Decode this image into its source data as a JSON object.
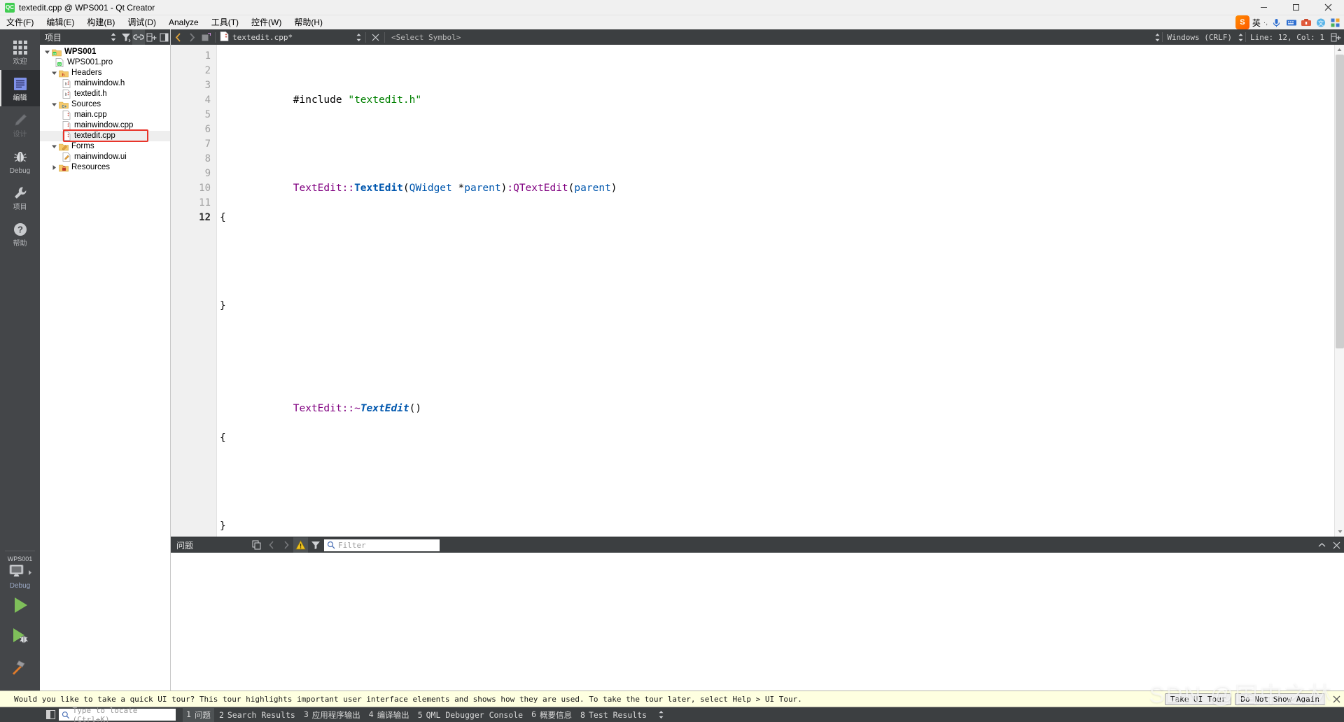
{
  "window": {
    "title": "textedit.cpp @ WPS001 - Qt Creator",
    "app_icon": "qt-creator-icon",
    "minimize": "minimize-button",
    "maximize": "maximize-button",
    "close": "close-button"
  },
  "menubar": {
    "items": [
      {
        "label": "文件(F)",
        "name": "menu-file"
      },
      {
        "label": "编辑(E)",
        "name": "menu-edit"
      },
      {
        "label": "构建(B)",
        "name": "menu-build"
      },
      {
        "label": "调试(D)",
        "name": "menu-debug"
      },
      {
        "label": "Analyze",
        "name": "menu-analyze"
      },
      {
        "label": "工具(T)",
        "name": "menu-tools"
      },
      {
        "label": "控件(W)",
        "name": "menu-window"
      },
      {
        "label": "帮助(H)",
        "name": "menu-help"
      }
    ],
    "ime": {
      "logo": "S",
      "lang": "英",
      "dot": "·,"
    }
  },
  "modebar": {
    "modes": [
      {
        "label": "欢迎",
        "icon": "grid-icon",
        "state": "normal"
      },
      {
        "label": "编辑",
        "icon": "edit-lines-icon",
        "state": "active"
      },
      {
        "label": "设计",
        "icon": "pencil-icon",
        "state": "disabled"
      },
      {
        "label": "Debug",
        "icon": "bug-icon",
        "state": "normal"
      },
      {
        "label": "项目",
        "icon": "wrench-icon",
        "state": "normal"
      },
      {
        "label": "帮助",
        "icon": "question-circle-icon",
        "state": "normal"
      }
    ],
    "kit": {
      "project": "WPS001",
      "config": "Debug",
      "icon": "desktop-icon"
    },
    "actions": [
      {
        "name": "run-button",
        "icon": "play-icon"
      },
      {
        "name": "debug-button",
        "icon": "play-bug-icon"
      },
      {
        "name": "build-button",
        "icon": "hammer-icon"
      }
    ]
  },
  "project_panel": {
    "title": "项目",
    "toolbar": [
      {
        "name": "filter-tree-sort-icon",
        "icon": "sort-updown-icon"
      },
      {
        "name": "filter-tree-icon",
        "icon": "funnel-icon"
      },
      {
        "name": "sync-with-editor-icon",
        "icon": "link-icon"
      },
      {
        "name": "expand-all-icon",
        "icon": "expand-plus-icon"
      },
      {
        "name": "close-sidebar-icon",
        "icon": "panel-close-icon"
      }
    ],
    "tree": [
      {
        "label": "WPS001",
        "icon": "qt-project-folder-icon",
        "indent": 0,
        "arrow": "down",
        "bold": true,
        "selected": false
      },
      {
        "label": "WPS001.pro",
        "icon": "qt-pro-file-icon",
        "indent": 1,
        "arrow": "none",
        "bold": false,
        "selected": false
      },
      {
        "label": "Headers",
        "icon": "folder-h-icon",
        "indent": 1,
        "arrow": "down",
        "bold": false,
        "selected": false
      },
      {
        "label": "mainwindow.h",
        "icon": "header-file-icon",
        "indent": 2,
        "arrow": "none",
        "bold": false,
        "selected": false
      },
      {
        "label": "textedit.h",
        "icon": "header-file-icon",
        "indent": 2,
        "arrow": "none",
        "bold": false,
        "selected": false
      },
      {
        "label": "Sources",
        "icon": "folder-cpp-icon",
        "indent": 1,
        "arrow": "down",
        "bold": false,
        "selected": false
      },
      {
        "label": "main.cpp",
        "icon": "source-file-icon",
        "indent": 2,
        "arrow": "none",
        "bold": false,
        "selected": false
      },
      {
        "label": "mainwindow.cpp",
        "icon": "source-file-icon",
        "indent": 2,
        "arrow": "none",
        "bold": false,
        "selected": false
      },
      {
        "label": "textedit.cpp",
        "icon": "source-file-icon",
        "indent": 2,
        "arrow": "none",
        "bold": false,
        "selected": true,
        "highlight": true
      },
      {
        "label": "Forms",
        "icon": "folder-forms-icon",
        "indent": 1,
        "arrow": "down",
        "bold": false,
        "selected": false
      },
      {
        "label": "mainwindow.ui",
        "icon": "ui-file-icon",
        "indent": 2,
        "arrow": "none",
        "bold": false,
        "selected": false
      },
      {
        "label": "Resources",
        "icon": "folder-resources-icon",
        "indent": 1,
        "arrow": "right",
        "bold": false,
        "selected": false
      }
    ],
    "highlight_color": "#e8342a"
  },
  "editor_toolbar": {
    "back": "back-arrow-icon",
    "forward": "forward-arrow-icon",
    "split": "split-editor-icon",
    "document": "textedit.cpp*",
    "document_icon": "source-file-icon",
    "close_document": "close-document-icon",
    "symbol": "<Select Symbol>",
    "line_ending": "Windows (CRLF)",
    "cursor_position": "Line: 12, Col: 1",
    "add_split": "split-add-icon"
  },
  "code": {
    "line_numbers": [
      "1",
      "2",
      "3",
      "4",
      "5",
      "6",
      "7",
      "8",
      "9",
      "10",
      "11",
      "12"
    ],
    "current_line": 12,
    "lines": [
      {
        "n": 1,
        "tokens": [
          {
            "t": "#include ",
            "c": "pre"
          },
          {
            "t": "\"textedit.h\"",
            "c": "str"
          }
        ]
      },
      {
        "n": 2,
        "tokens": []
      },
      {
        "n": 3,
        "tokens": [
          {
            "t": "TextEdit",
            "c": "type"
          },
          {
            "t": "::",
            "c": "type"
          },
          {
            "t": "TextEdit",
            "c": "fn"
          },
          {
            "t": "(",
            "c": "plain"
          },
          {
            "t": "QWidget",
            "c": "cls"
          },
          {
            "t": " *",
            "c": "plain"
          },
          {
            "t": "parent",
            "c": "var"
          },
          {
            "t": ")",
            "c": "plain"
          },
          {
            "t": ":",
            "c": "type"
          },
          {
            "t": "QTextEdit",
            "c": "type"
          },
          {
            "t": "(",
            "c": "plain"
          },
          {
            "t": "parent",
            "c": "var"
          },
          {
            "t": ")",
            "c": "plain"
          }
        ]
      },
      {
        "n": 4,
        "tokens": [
          {
            "t": "{",
            "c": "plain"
          }
        ]
      },
      {
        "n": 5,
        "tokens": []
      },
      {
        "n": 6,
        "tokens": [
          {
            "t": "}",
            "c": "plain"
          }
        ]
      },
      {
        "n": 7,
        "tokens": []
      },
      {
        "n": 8,
        "tokens": [
          {
            "t": "TextEdit",
            "c": "type"
          },
          {
            "t": "::~",
            "c": "type"
          },
          {
            "t": "TextEdit",
            "c": "fni"
          },
          {
            "t": "()",
            "c": "plain"
          }
        ]
      },
      {
        "n": 9,
        "tokens": [
          {
            "t": "{",
            "c": "plain"
          }
        ]
      },
      {
        "n": 10,
        "tokens": []
      },
      {
        "n": 11,
        "tokens": [
          {
            "t": "}",
            "c": "plain"
          }
        ]
      },
      {
        "n": 12,
        "tokens": []
      }
    ],
    "change_bars": [
      3,
      5,
      7,
      8,
      9,
      10,
      11
    ],
    "fold_markers": [
      3,
      8
    ]
  },
  "issues_panel": {
    "title": "问题",
    "toolbar": [
      {
        "name": "copy-issues-icon",
        "icon": "copy-icon"
      },
      {
        "name": "prev-issue-icon",
        "icon": "chevron-left-icon"
      },
      {
        "name": "next-issue-icon",
        "icon": "chevron-right-icon"
      },
      {
        "name": "warnings-filter-icon",
        "icon": "warning-triangle-icon"
      },
      {
        "name": "filter-icon",
        "icon": "funnel-icon"
      }
    ],
    "filter_placeholder": "Filter",
    "maximize": "maximize-pane-icon",
    "close": "close-pane-icon"
  },
  "banner": {
    "text": "Would you like to take a quick UI tour? This tour highlights important user interface elements and shows how they are used. To take the tour later, select Help > UI Tour.",
    "primary_button": "Take UI Tour",
    "secondary_button": "Do Not Show Again",
    "close": "close-banner-icon",
    "background": "#feffe0"
  },
  "statusbar": {
    "toggle_sidebar": "toggle-sidebar-icon",
    "locator_placeholder": "Type to locate (Ctrl+K)",
    "panes": [
      {
        "num": "1",
        "label": "问题",
        "active": true
      },
      {
        "num": "2",
        "label": "Search Results",
        "active": false
      },
      {
        "num": "3",
        "label": "应用程序输出",
        "active": false
      },
      {
        "num": "4",
        "label": "编译输出",
        "active": false
      },
      {
        "num": "5",
        "label": "QML Debugger Console",
        "active": false
      },
      {
        "num": "6",
        "label": "概要信息",
        "active": false
      },
      {
        "num": "8",
        "label": "Test Results",
        "active": false
      }
    ]
  },
  "watermark": "SDN @国中之林"
}
